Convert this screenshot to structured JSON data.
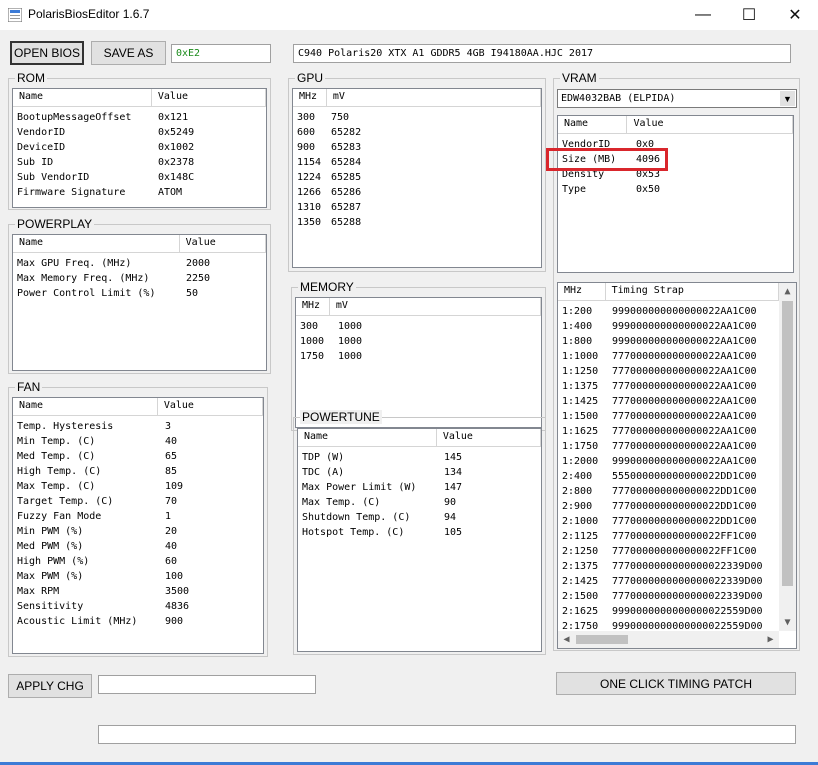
{
  "window": {
    "title": "PolarisBiosEditor 1.6.7",
    "minimize": "—",
    "maximize": "☐",
    "close": "✕"
  },
  "toolbar": {
    "open_label": "OPEN BIOS",
    "save_label": "SAVE AS",
    "checksum": "0xE2",
    "bios_name": "C940 Polaris20 XTX A1 GDDR5 4GB I94180AA.HJC 2017"
  },
  "rom": {
    "label": "ROM",
    "headers": [
      "Name",
      "Value"
    ],
    "rows": [
      [
        "BootupMessageOffset",
        "0x121"
      ],
      [
        "VendorID",
        "0x5249"
      ],
      [
        "DeviceID",
        "0x1002"
      ],
      [
        "Sub ID",
        "0x2378"
      ],
      [
        "Sub VendorID",
        "0x148C"
      ],
      [
        "Firmware Signature",
        "ATOM"
      ]
    ]
  },
  "powerplay": {
    "label": "POWERPLAY",
    "headers": [
      "Name",
      "Value"
    ],
    "rows": [
      [
        "Max GPU Freq. (MHz)",
        "2000"
      ],
      [
        "Max Memory Freq. (MHz)",
        "2250"
      ],
      [
        "Power Control Limit (%)",
        "50"
      ]
    ]
  },
  "fan": {
    "label": "FAN",
    "headers": [
      "Name",
      "Value"
    ],
    "rows": [
      [
        "Temp. Hysteresis",
        "3"
      ],
      [
        "Min Temp. (C)",
        "40"
      ],
      [
        "Med Temp. (C)",
        "65"
      ],
      [
        "High Temp. (C)",
        "85"
      ],
      [
        "Max Temp. (C)",
        "109"
      ],
      [
        "Target Temp. (C)",
        "70"
      ],
      [
        "Fuzzy Fan Mode",
        "1"
      ],
      [
        "Min PWM (%)",
        "20"
      ],
      [
        "Med PWM (%)",
        "40"
      ],
      [
        "High PWM (%)",
        "60"
      ],
      [
        "Max PWM (%)",
        "100"
      ],
      [
        "Max RPM",
        "3500"
      ],
      [
        "Sensitivity",
        "4836"
      ],
      [
        "Acoustic Limit (MHz)",
        "900"
      ]
    ]
  },
  "gpu": {
    "label": "GPU",
    "headers": [
      "MHz",
      "mV"
    ],
    "rows": [
      [
        "300",
        "750"
      ],
      [
        "600",
        "65282"
      ],
      [
        "900",
        "65283"
      ],
      [
        "1154",
        "65284"
      ],
      [
        "1224",
        "65285"
      ],
      [
        "1266",
        "65286"
      ],
      [
        "1310",
        "65287"
      ],
      [
        "1350",
        "65288"
      ]
    ]
  },
  "memory": {
    "label": "MEMORY",
    "headers": [
      "MHz",
      "mV"
    ],
    "rows": [
      [
        "300",
        "1000"
      ],
      [
        "1000",
        "1000"
      ],
      [
        "1750",
        "1000"
      ]
    ]
  },
  "powertune": {
    "label": "POWERTUNE",
    "headers": [
      "Name",
      "Value"
    ],
    "rows": [
      [
        "TDP (W)",
        "145"
      ],
      [
        "TDC (A)",
        "134"
      ],
      [
        "Max Power Limit (W)",
        "147"
      ],
      [
        "Max Temp. (C)",
        "90"
      ],
      [
        "Shutdown Temp. (C)",
        "94"
      ],
      [
        "Hotspot Temp. (C)",
        "105"
      ]
    ]
  },
  "vram": {
    "label": "VRAM",
    "selected": "EDW4032BAB (ELPIDA)",
    "headers": [
      "Name",
      "Value"
    ],
    "rows": [
      [
        "VendorID",
        "0x0"
      ],
      [
        "Size (MB)",
        "4096"
      ],
      [
        "Density",
        "0x53"
      ],
      [
        "Type",
        "0x50"
      ]
    ],
    "highlight_color": "#d9262c"
  },
  "timing": {
    "headers": [
      "MHz",
      "Timing Strap"
    ],
    "rows": [
      [
        "1:200",
        "999000000000000022AA1C00"
      ],
      [
        "1:400",
        "999000000000000022AA1C00"
      ],
      [
        "1:800",
        "999000000000000022AA1C00"
      ],
      [
        "1:1000",
        "777000000000000022AA1C00"
      ],
      [
        "1:1250",
        "777000000000000022AA1C00"
      ],
      [
        "1:1375",
        "777000000000000022AA1C00"
      ],
      [
        "1:1425",
        "777000000000000022AA1C00"
      ],
      [
        "1:1500",
        "777000000000000022AA1C00"
      ],
      [
        "1:1625",
        "777000000000000022AA1C00"
      ],
      [
        "1:1750",
        "777000000000000022AA1C00"
      ],
      [
        "1:2000",
        "999000000000000022AA1C00"
      ],
      [
        "2:400",
        "555000000000000022DD1C00"
      ],
      [
        "2:800",
        "777000000000000022DD1C00"
      ],
      [
        "2:900",
        "777000000000000022DD1C00"
      ],
      [
        "2:1000",
        "777000000000000022DD1C00"
      ],
      [
        "2:1125",
        "777000000000000022FF1C00"
      ],
      [
        "2:1250",
        "777000000000000022FF1C00"
      ],
      [
        "2:1375",
        "7770000000000000022339D00"
      ],
      [
        "2:1425",
        "7770000000000000022339D00"
      ],
      [
        "2:1500",
        "7770000000000000022339D00"
      ],
      [
        "2:1625",
        "9990000000000000022559D00"
      ],
      [
        "2:1750",
        "9990000000000000022559D00"
      ]
    ]
  },
  "bottom": {
    "apply_label": "APPLY CHG",
    "apply_value": "",
    "timing_patch_label": "ONE CLICK TIMING PATCH",
    "status_value": ""
  }
}
